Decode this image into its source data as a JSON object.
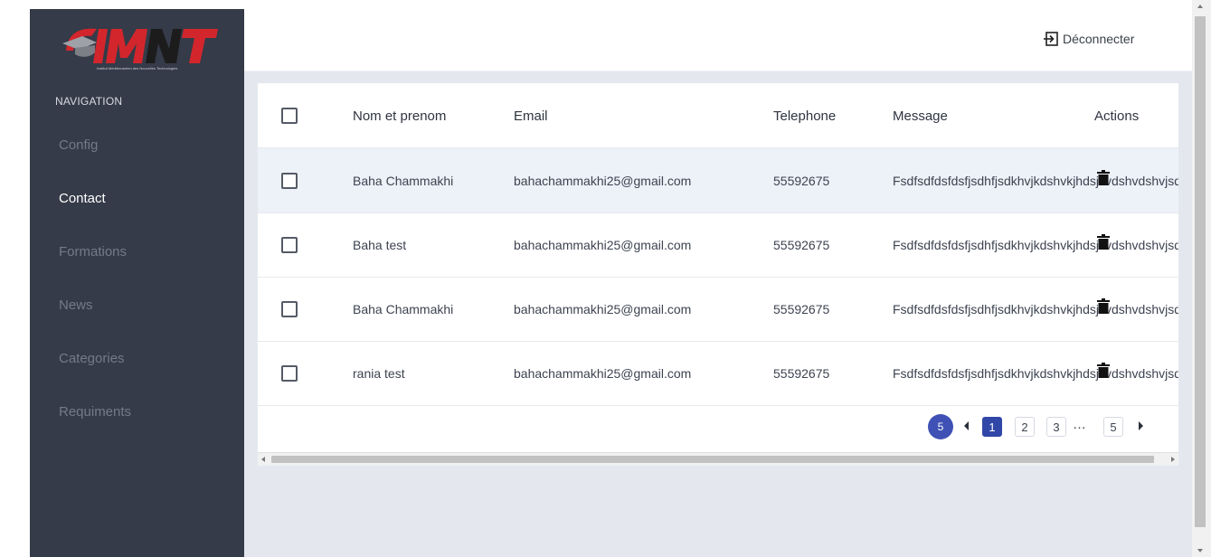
{
  "brand": {
    "logo_text": "IMNT",
    "logo_tagline": "Institut Méditerranéen des Nouvelles Technologies",
    "accent_color": "#d3262c"
  },
  "sidebar": {
    "nav_title": "NAVIGATION",
    "items": [
      {
        "label": "Config",
        "active": false
      },
      {
        "label": "Contact",
        "active": true
      },
      {
        "label": "Formations",
        "active": false
      },
      {
        "label": "News",
        "active": false
      },
      {
        "label": "Categories",
        "active": false
      },
      {
        "label": "Requiments",
        "active": false
      }
    ]
  },
  "header": {
    "logout_label": "Déconnecter",
    "logout_icon": "sign-out-icon"
  },
  "table": {
    "columns": [
      "Nom et prenom",
      "Email",
      "Telephone",
      "Message",
      "Actions"
    ],
    "rows": [
      {
        "name": "Baha Chammakhi",
        "email": "bahachammakhi25@gmail.com",
        "telephone": "55592675",
        "message": "Fsdfsdfdsfdsfjsdhfjsdkhvjkdshvkjhdsjkvdshvdshvjsdv",
        "action_icon": "trash-icon"
      },
      {
        "name": "Baha test",
        "email": "bahachammakhi25@gmail.com",
        "telephone": "55592675",
        "message": "Fsdfsdfdsfdsfjsdhfjsdkhvjkdshvkjhdsjkvdshvdshvjsdv",
        "action_icon": "trash-icon"
      },
      {
        "name": "Baha Chammakhi",
        "email": "bahachammakhi25@gmail.com",
        "telephone": "55592675",
        "message": "Fsdfsdfdsfdsfjsdhfjsdkhvjkdshvkjhdsjkvdshvdshvjsdv",
        "action_icon": "trash-icon"
      },
      {
        "name": "rania test",
        "email": "bahachammakhi25@gmail.com",
        "telephone": "55592675",
        "message": "Fsdfsdfdsfdsfjsdhfjsdkhvjkdshvkjhdsjkvdshvdshvjsdv",
        "action_icon": "trash-icon"
      }
    ]
  },
  "pagination": {
    "page_size": "5",
    "pages": [
      "1",
      "2",
      "3",
      "…",
      "5"
    ],
    "current_page": "1"
  },
  "colors": {
    "sidebar_bg": "#353b48",
    "main_bg": "#e4e8ee",
    "highlight_row": "#edf1f8",
    "pagination_active": "#3147a8"
  }
}
